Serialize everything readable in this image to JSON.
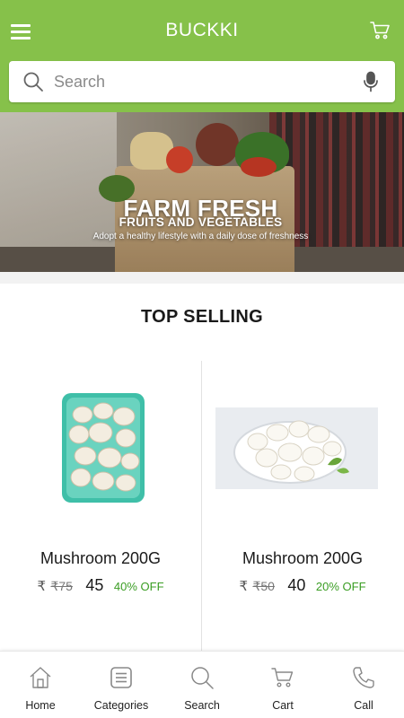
{
  "header": {
    "title": "BUCKKI",
    "menu_icon": "hamburger-menu-icon",
    "cart_icon": "cart-icon",
    "background_color": "#86c14a"
  },
  "search": {
    "placeholder": "Search",
    "value": "",
    "search_icon": "search-icon",
    "voice_icon": "microphone-icon"
  },
  "banner": {
    "title": "FARM FRESH",
    "subtitle": "FRUITS AND VEGETABLES",
    "tagline": "Adopt a healthy lifestyle with a daily dose of freshness"
  },
  "top_selling": {
    "title": "TOP SELLING",
    "products": [
      {
        "name": "Mushroom 200G",
        "currency": "₹",
        "old_price": "₹75",
        "price": "45",
        "discount": "40% OFF",
        "image": "mushroom-punnet-photo"
      },
      {
        "name": "Mushroom 200G",
        "currency": "₹",
        "old_price": "₹50",
        "price": "40",
        "discount": "20% OFF",
        "image": "mushroom-bowl-photo"
      }
    ],
    "discount_color": "#3a9d23"
  },
  "bottom_nav": {
    "items": [
      {
        "label": "Home",
        "icon": "home-icon"
      },
      {
        "label": "Categories",
        "icon": "categories-icon"
      },
      {
        "label": "Search",
        "icon": "search-icon"
      },
      {
        "label": "Cart",
        "icon": "cart-icon"
      },
      {
        "label": "Call",
        "icon": "phone-icon"
      }
    ]
  }
}
